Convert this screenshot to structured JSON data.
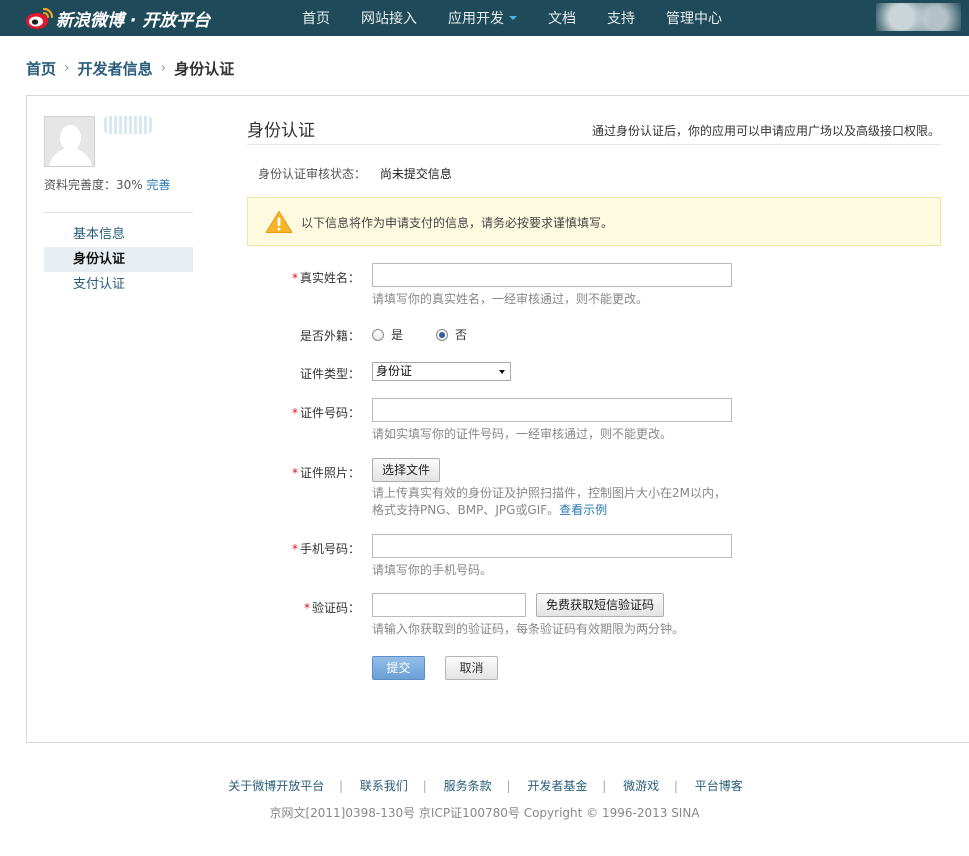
{
  "header": {
    "logo_text": "新浪微博 · 开放平台",
    "nav": [
      {
        "label": "首页"
      },
      {
        "label": "网站接入"
      },
      {
        "label": "应用开发"
      },
      {
        "label": "文档"
      },
      {
        "label": "支持"
      },
      {
        "label": "管理中心"
      }
    ]
  },
  "breadcrumb": {
    "items": [
      "首页",
      "开发者信息"
    ],
    "current": "身份认证"
  },
  "sidebar": {
    "completeness_label": "资料完善度：30%",
    "completeness_link": "完善",
    "menu": [
      {
        "label": "基本信息",
        "active": false
      },
      {
        "label": "身份认证",
        "active": true
      },
      {
        "label": "支付认证",
        "active": false
      }
    ]
  },
  "content": {
    "title": "身份认证",
    "subtitle": "通过身份认证后，你的应用可以申请应用广场以及高级接口权限。",
    "status_label": "身份认证审核状态：",
    "status_value": "尚未提交信息",
    "notice": "以下信息将作为申请支付的信息，请务必按要求谨慎填写。"
  },
  "form": {
    "real_name": {
      "label": "真实姓名：",
      "value": "",
      "hint": "请填写你的真实姓名，一经审核通过，则不能更改。"
    },
    "foreign": {
      "label": "是否外籍：",
      "options": [
        "是",
        "否"
      ],
      "selected": "否"
    },
    "id_type": {
      "label": "证件类型：",
      "value": "身份证"
    },
    "id_number": {
      "label": "证件号码：",
      "value": "",
      "hint": "请如实填写你的证件号码，一经审核通过，则不能更改。"
    },
    "id_photo": {
      "label": "证件照片：",
      "button": "选择文件",
      "hint_line1": "请上传真实有效的身份证及护照扫描件，控制图片大小在2M以内，",
      "hint_line2": "格式支持PNG、BMP、JPG或GIF。",
      "hint_link": "查看示例"
    },
    "phone": {
      "label": "手机号码：",
      "value": "",
      "hint": "请填写你的手机号码。"
    },
    "verify_code": {
      "label": "验证码：",
      "value": "",
      "button": "免费获取短信验证码",
      "hint": "请输入你获取到的验证码，每条验证码有效期限为两分钟。"
    },
    "submit": "提交",
    "cancel": "取消"
  },
  "footer": {
    "links": [
      "关于微博开放平台",
      "联系我们",
      "服务条款",
      "开发者基金",
      "微游戏",
      "平台博客"
    ],
    "separator": "|",
    "copyright": "京网文[2011]0398-130号 京ICP证100780号 Copyright © 1996-2013 SINA"
  },
  "colors": {
    "topbar": "#1f4a5a",
    "link": "#2a5d7a",
    "required": "#d12",
    "notice_bg": "#fffbe0",
    "primary_button": "#6b9fd6"
  }
}
